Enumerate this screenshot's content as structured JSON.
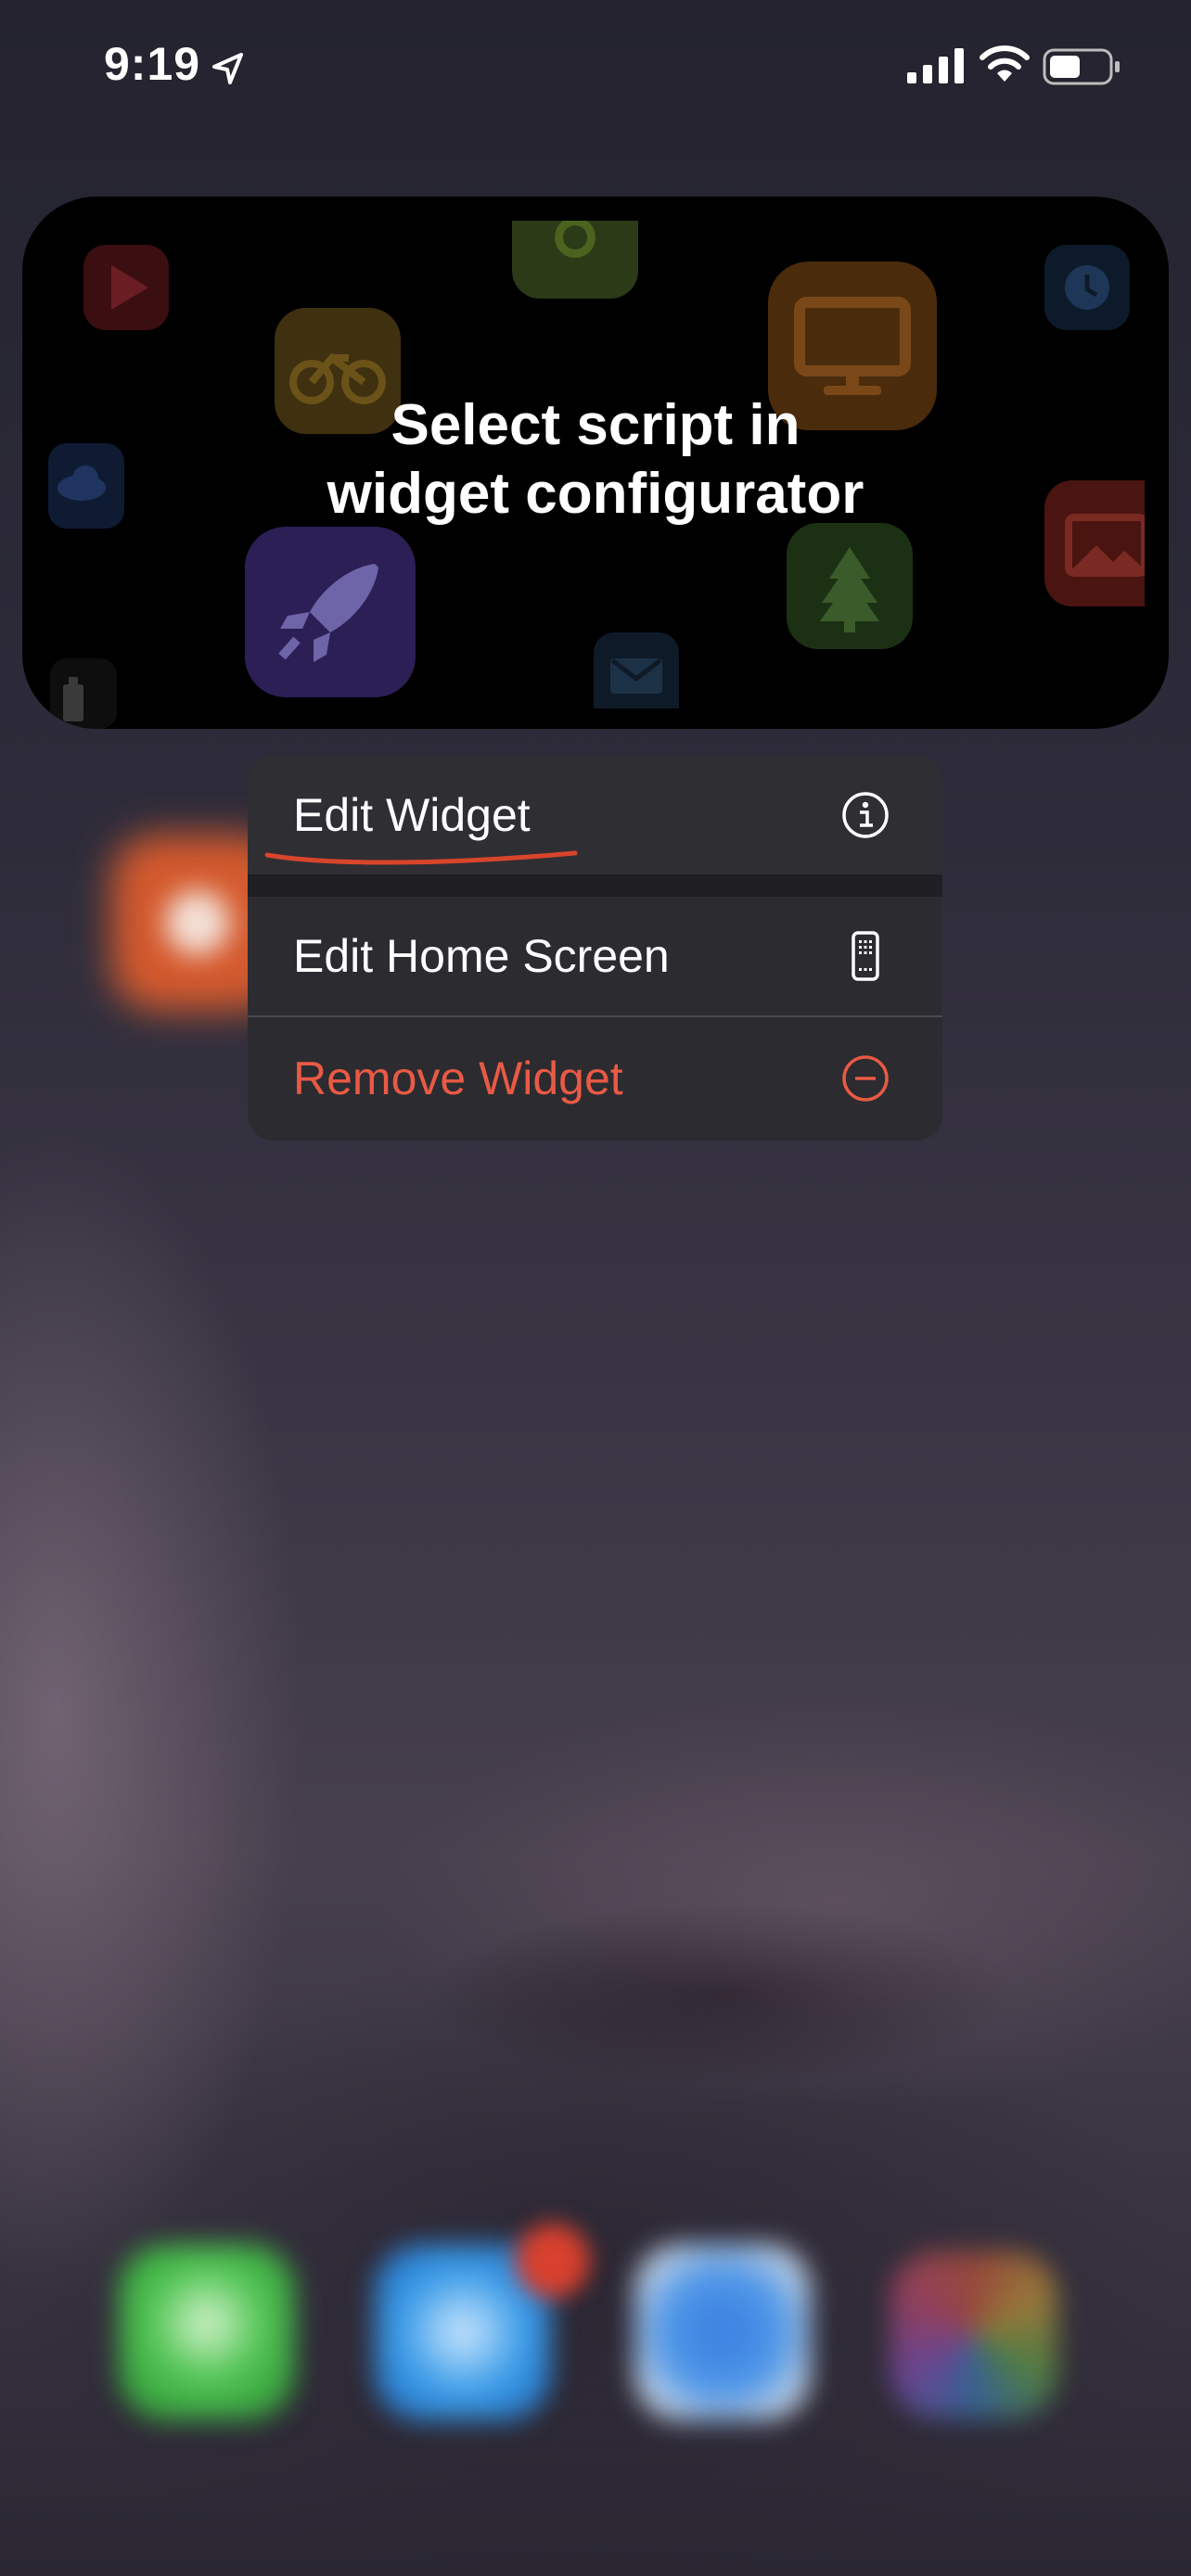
{
  "status_bar": {
    "time": "9:19",
    "icons": [
      "location-arrow-icon",
      "cellular-signal-icon",
      "wifi-icon",
      "battery-icon"
    ]
  },
  "widget": {
    "message_line1": "Select script in",
    "message_line2": "widget configurator",
    "background_icons": [
      "play-icon",
      "sun-icon",
      "monitor-icon",
      "clock-icon",
      "bicycle-icon",
      "cloud-icon",
      "rocket-icon",
      "tree-icon",
      "image-icon",
      "mail-icon",
      "battery-icon"
    ]
  },
  "context_menu": {
    "items": [
      {
        "label": "Edit Widget",
        "icon": "info-icon",
        "color": "#ffffff"
      },
      {
        "label": "Edit Home Screen",
        "icon": "phone-icon",
        "color": "#ffffff"
      },
      {
        "label": "Remove Widget",
        "icon": "minus-circle-icon",
        "color": "#e85a45"
      }
    ]
  },
  "annotation": {
    "underline_color": "#d8452b"
  },
  "dock": {
    "apps": [
      "messages-app",
      "mail-app",
      "safari-app",
      "photos-app"
    ]
  }
}
